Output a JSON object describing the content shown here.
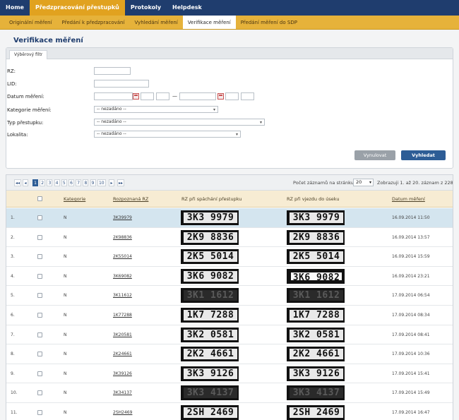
{
  "topnav": [
    {
      "label": "Home",
      "active": false
    },
    {
      "label": "Předzpracování přestupků",
      "active": true
    },
    {
      "label": "Protokoly",
      "active": false
    },
    {
      "label": "Helpdesk",
      "active": false
    }
  ],
  "subnav": [
    {
      "label": "Originální měření",
      "active": false
    },
    {
      "label": "Předání k předzpracování",
      "active": false
    },
    {
      "label": "Vyhledání měření",
      "active": false
    },
    {
      "label": "Verifikace měření",
      "active": true
    },
    {
      "label": "Předání měření do SDP",
      "active": false
    }
  ],
  "page_title": "Verifikace měření",
  "filter": {
    "tab_label": "Výběrový filtr",
    "rz_label": "RZ:",
    "lid_label": "LID:",
    "date_label": "Datum měření:",
    "date_sep": "—",
    "category_label": "Kategorie měření:",
    "category_value": "-- nezadáno --",
    "offense_label": "Typ přestupku:",
    "offense_value": "-- nezadáno --",
    "location_label": "Lokalita:",
    "location_value": "-- nezadáno --",
    "reset_label": "Vynulovat",
    "search_label": "Vyhledat"
  },
  "pager": {
    "first": "◂◂",
    "prev": "◂",
    "pages": [
      "1",
      "2",
      "3",
      "4",
      "5",
      "6",
      "7",
      "8",
      "9",
      "10"
    ],
    "current_page": "1",
    "next": "▸",
    "last": "▸▸",
    "per_page_label": "Počet záznamů na stránku:",
    "per_page_value": "20",
    "summary": "Zobrazuji 1. až 20. záznam z 228."
  },
  "table": {
    "headers": {
      "category": "Kategorie",
      "rz": "Rozpoznaná RZ",
      "rz_offense": "RZ při spáchání přestupku",
      "rz_entry": "RZ při vjezdu do úseku",
      "date": "Datum měření"
    },
    "rows": [
      {
        "num": "1.",
        "cat": "N",
        "rz": "3K39979",
        "plate": "3K3 9979",
        "date": "16.09.2014 11:50",
        "selected": true,
        "dark": false
      },
      {
        "num": "2.",
        "cat": "N",
        "rz": "2K98836",
        "plate": "2K9 8836",
        "date": "16.09.2014 13:57",
        "selected": false,
        "dark": false
      },
      {
        "num": "3.",
        "cat": "N",
        "rz": "2K55014",
        "plate": "2K5 5014",
        "date": "16.09.2014 15:59",
        "selected": false,
        "dark": false
      },
      {
        "num": "4.",
        "cat": "N",
        "rz": "3K69082",
        "plate": "3K6 9082",
        "date": "16.09.2014 23:21",
        "selected": false,
        "dark": false
      },
      {
        "num": "5.",
        "cat": "N",
        "rz": "3K11612",
        "plate": "3K1 1612",
        "date": "17.09.2014 06:54",
        "selected": false,
        "dark": true
      },
      {
        "num": "6.",
        "cat": "N",
        "rz": "1K77288",
        "plate": "1K7 7288",
        "date": "17.09.2014 08:34",
        "selected": false,
        "dark": false
      },
      {
        "num": "7.",
        "cat": "N",
        "rz": "3K20581",
        "plate": "3K2 0581",
        "date": "17.09.2014 08:41",
        "selected": false,
        "dark": false
      },
      {
        "num": "8.",
        "cat": "N",
        "rz": "2K24661",
        "plate": "2K2 4661",
        "date": "17.09.2014 10:36",
        "selected": false,
        "dark": false
      },
      {
        "num": "9.",
        "cat": "N",
        "rz": "3K39126",
        "plate": "3K3 9126",
        "date": "17.09.2014 15:41",
        "selected": false,
        "dark": false
      },
      {
        "num": "10.",
        "cat": "N",
        "rz": "3K34137",
        "plate": "3K3 4137",
        "date": "17.09.2014 15:49",
        "selected": false,
        "dark": true
      },
      {
        "num": "11.",
        "cat": "N",
        "rz": "2SH2469",
        "plate": "2SH 2469",
        "date": "17.09.2014 16:47",
        "selected": false,
        "dark": false
      }
    ]
  },
  "colors": {
    "nav": "#1f3d6e",
    "nav_active": "#e1a21f",
    "subnav": "#e6b23a",
    "header_row": "#f7ecd3",
    "selected_row": "#d4e5ef",
    "button_primary": "#2d5d96"
  }
}
